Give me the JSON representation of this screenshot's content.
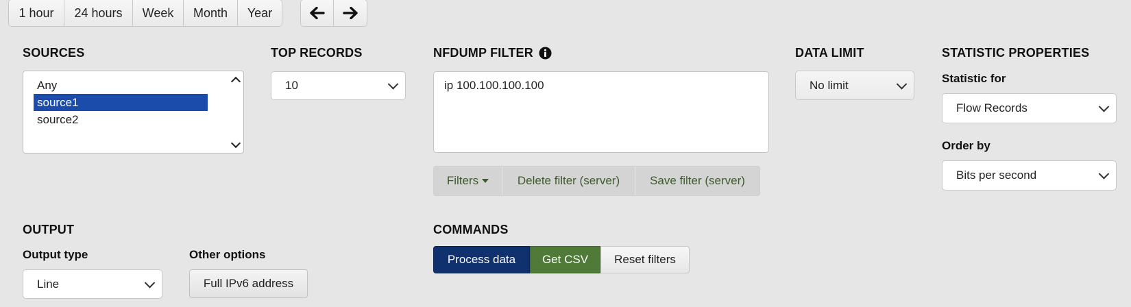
{
  "time_range": {
    "buttons": [
      "1 hour",
      "24 hours",
      "Week",
      "Month",
      "Year"
    ],
    "prev_label": "🡐",
    "next_label": "🡒"
  },
  "sources": {
    "heading": "SOURCES",
    "options": [
      "Any",
      "source1",
      "source2"
    ],
    "selected": "source1"
  },
  "top_records": {
    "heading": "TOP RECORDS",
    "value": "10"
  },
  "nfdump_filter": {
    "heading": "NFDUMP FILTER",
    "info_icon": "info-circle-icon",
    "value": "ip 100.100.100.100",
    "filters_label": "Filters",
    "delete_label": "Delete filter (server)",
    "save_label": "Save filter (server)"
  },
  "data_limit": {
    "heading": "DATA LIMIT",
    "value": "No limit"
  },
  "statistic_properties": {
    "heading": "STATISTIC PROPERTIES",
    "statistic_for_label": "Statistic for",
    "statistic_for_value": "Flow Records",
    "order_by_label": "Order by",
    "order_by_value": "Bits per second"
  },
  "output": {
    "heading": "OUTPUT",
    "output_type_label": "Output type",
    "output_type_value": "Line",
    "other_options_label": "Other options",
    "ipv6_button": "Full IPv6 address"
  },
  "commands": {
    "heading": "COMMANDS",
    "process_label": "Process data",
    "csv_label": "Get CSV",
    "reset_label": "Reset filters"
  },
  "colors": {
    "process_bg": "#10306e",
    "csv_bg": "#4f7a37",
    "selected_option": "#1b4cab",
    "filter_text": "#3f5a2c"
  }
}
